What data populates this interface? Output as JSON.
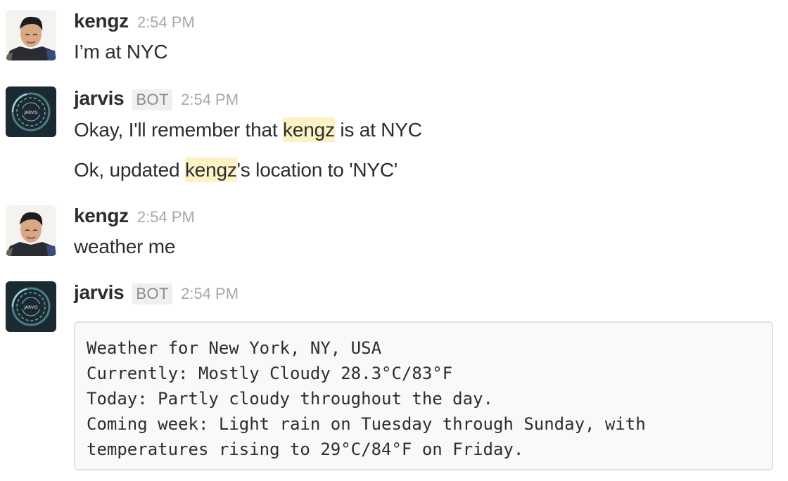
{
  "messages": [
    {
      "author": "kengz",
      "time": "2:54 PM",
      "lines": [
        "I’m at NYC"
      ]
    },
    {
      "author": "jarvis",
      "badge": "BOT",
      "time": "2:54 PM",
      "line1": {
        "before": "Okay, I'll remember that ",
        "mention": "kengz",
        "after": " is at NYC"
      },
      "line2": {
        "before": "Ok, updated ",
        "mention": "kengz",
        "after": "'s location to 'NYC'"
      }
    },
    {
      "author": "kengz",
      "time": "2:54 PM",
      "lines": [
        "weather me"
      ]
    },
    {
      "author": "jarvis",
      "badge": "BOT",
      "time": "2:54 PM",
      "code_lines": [
        "Weather for New York, NY, USA",
        "Currently: Mostly Cloudy 28.3°C/83°F",
        "Today: Partly cloudy throughout the day.",
        "Coming week: Light rain on Tuesday through Sunday, with",
        "temperatures rising to 29°C/84°F on Friday."
      ]
    }
  ],
  "avatar_labels": {
    "jarvis": "JARVIS"
  },
  "colors": {
    "mention_highlight": "#fdf2c4",
    "timestamp": "#a8a8aa",
    "text": "#2c2d30"
  }
}
